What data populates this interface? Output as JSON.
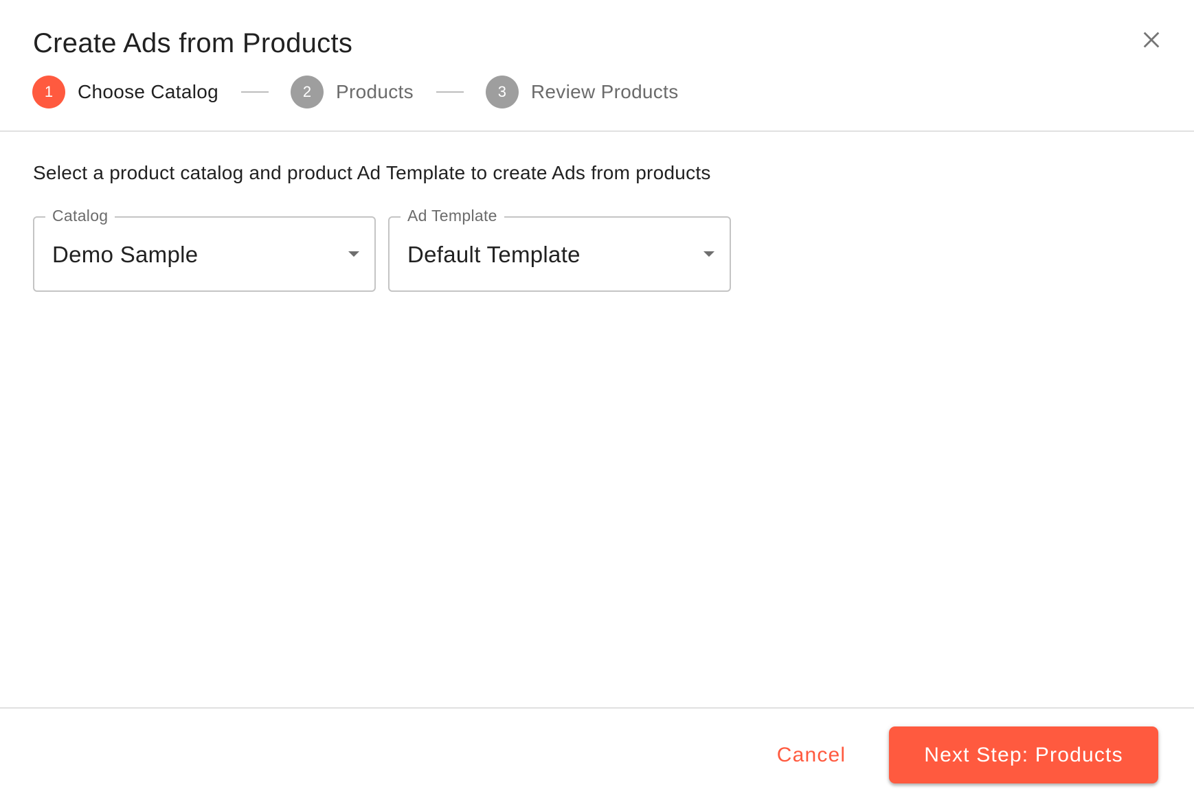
{
  "dialog": {
    "title": "Create Ads from Products",
    "close_icon": "close-icon"
  },
  "stepper": {
    "steps": [
      {
        "number": "1",
        "label": "Choose Catalog",
        "state": "active"
      },
      {
        "number": "2",
        "label": "Products",
        "state": "inactive"
      },
      {
        "number": "3",
        "label": "Review Products",
        "state": "inactive"
      }
    ]
  },
  "body": {
    "instructions": "Select a product catalog and product Ad Template to create Ads from products",
    "catalog_field": {
      "label": "Catalog",
      "value": "Demo Sample",
      "icon": "dropdown-arrow-icon"
    },
    "template_field": {
      "label": "Ad Template",
      "value": "Default Template",
      "icon": "dropdown-arrow-icon"
    }
  },
  "footer": {
    "cancel_label": "Cancel",
    "next_label": "Next Step: Products"
  },
  "colors": {
    "accent": "#ff5a3f",
    "inactive_step": "#9e9e9e",
    "divider": "#e0e0e0"
  }
}
